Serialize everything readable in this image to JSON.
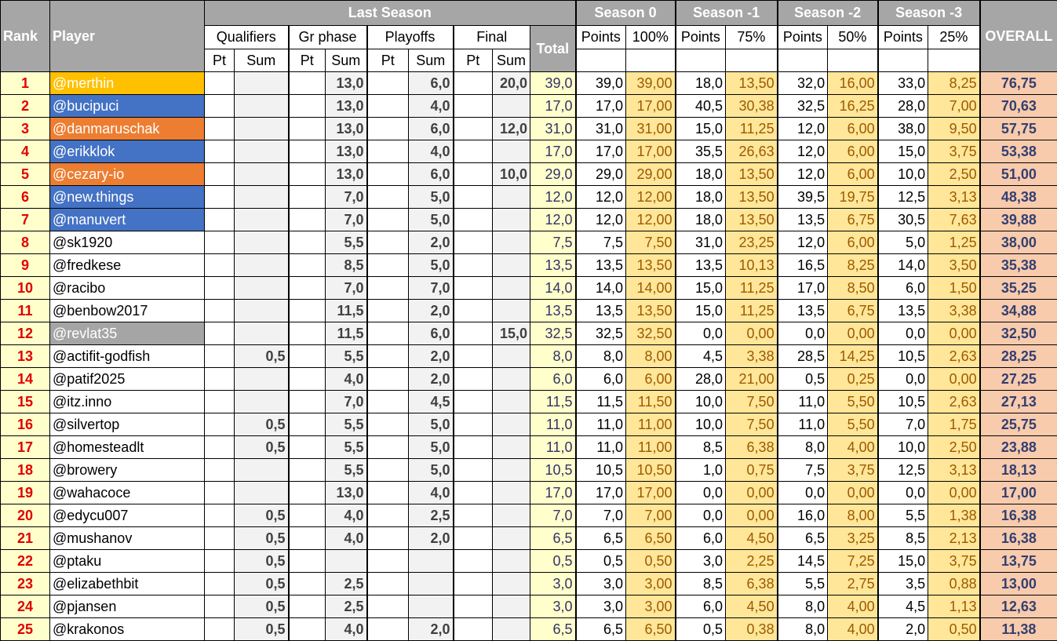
{
  "header": {
    "rank": "Rank",
    "player": "Player",
    "last_season": "Last Season",
    "total": "Total",
    "overall": "OVERALL",
    "stages": [
      "Qualifiers",
      "Gr phase",
      "Playoffs",
      "Final"
    ],
    "pt": "Pt",
    "sum": "Sum",
    "seasons": [
      {
        "name": "Season 0",
        "points": "Points",
        "weight": "100%"
      },
      {
        "name": "Season -1",
        "points": "Points",
        "weight": "75%"
      },
      {
        "name": "Season -2",
        "points": "Points",
        "weight": "50%"
      },
      {
        "name": "Season -3",
        "points": "Points",
        "weight": "25%"
      }
    ]
  },
  "colors": {
    "gold": "#ffc000",
    "blue": "#4472c4",
    "orange": "#ed7d31",
    "gray": "#a5a5a5"
  },
  "rows": [
    {
      "rank": "1",
      "player": "@merthin",
      "hl": "gold",
      "c": [
        "",
        "",
        "",
        "13,0",
        "",
        "6,0",
        "",
        "20,0",
        "39,0",
        "39,0",
        "39,00",
        "18,0",
        "13,50",
        "32,0",
        "16,00",
        "33,0",
        "8,25",
        "76,75"
      ]
    },
    {
      "rank": "2",
      "player": "@bucipuci",
      "hl": "blue",
      "c": [
        "",
        "",
        "",
        "13,0",
        "",
        "4,0",
        "",
        "",
        "17,0",
        "17,0",
        "17,00",
        "40,5",
        "30,38",
        "32,5",
        "16,25",
        "28,0",
        "7,00",
        "70,63"
      ]
    },
    {
      "rank": "3",
      "player": "@danmaruschak",
      "hl": "orange",
      "c": [
        "",
        "",
        "",
        "13,0",
        "",
        "6,0",
        "",
        "12,0",
        "31,0",
        "31,0",
        "31,00",
        "15,0",
        "11,25",
        "12,0",
        "6,00",
        "38,0",
        "9,50",
        "57,75"
      ]
    },
    {
      "rank": "4",
      "player": "@erikklok",
      "hl": "blue",
      "c": [
        "",
        "",
        "",
        "13,0",
        "",
        "4,0",
        "",
        "",
        "17,0",
        "17,0",
        "17,00",
        "35,5",
        "26,63",
        "12,0",
        "6,00",
        "15,0",
        "3,75",
        "53,38"
      ]
    },
    {
      "rank": "5",
      "player": "@cezary-io",
      "hl": "orange",
      "c": [
        "",
        "",
        "",
        "13,0",
        "",
        "6,0",
        "",
        "10,0",
        "29,0",
        "29,0",
        "29,00",
        "18,0",
        "13,50",
        "12,0",
        "6,00",
        "10,0",
        "2,50",
        "51,00"
      ]
    },
    {
      "rank": "6",
      "player": "@new.things",
      "hl": "blue",
      "c": [
        "",
        "",
        "",
        "7,0",
        "",
        "5,0",
        "",
        "",
        "12,0",
        "12,0",
        "12,00",
        "18,0",
        "13,50",
        "39,5",
        "19,75",
        "12,5",
        "3,13",
        "48,38"
      ]
    },
    {
      "rank": "7",
      "player": "@manuvert",
      "hl": "blue",
      "c": [
        "",
        "",
        "",
        "7,0",
        "",
        "5,0",
        "",
        "",
        "12,0",
        "12,0",
        "12,00",
        "18,0",
        "13,50",
        "13,5",
        "6,75",
        "30,5",
        "7,63",
        "39,88"
      ]
    },
    {
      "rank": "8",
      "player": "@sk1920",
      "hl": "",
      "c": [
        "",
        "",
        "",
        "5,5",
        "",
        "2,0",
        "",
        "",
        "7,5",
        "7,5",
        "7,50",
        "31,0",
        "23,25",
        "12,0",
        "6,00",
        "5,0",
        "1,25",
        "38,00"
      ]
    },
    {
      "rank": "9",
      "player": "@fredkese",
      "hl": "",
      "c": [
        "",
        "",
        "",
        "8,5",
        "",
        "5,0",
        "",
        "",
        "13,5",
        "13,5",
        "13,50",
        "13,5",
        "10,13",
        "16,5",
        "8,25",
        "14,0",
        "3,50",
        "35,38"
      ]
    },
    {
      "rank": "10",
      "player": "@racibo",
      "hl": "",
      "c": [
        "",
        "",
        "",
        "7,0",
        "",
        "7,0",
        "",
        "",
        "14,0",
        "14,0",
        "14,00",
        "15,0",
        "11,25",
        "17,0",
        "8,50",
        "6,0",
        "1,50",
        "35,25"
      ]
    },
    {
      "rank": "11",
      "player": "@benbow2017",
      "hl": "",
      "c": [
        "",
        "",
        "",
        "11,5",
        "",
        "2,0",
        "",
        "",
        "13,5",
        "13,5",
        "13,50",
        "15,0",
        "11,25",
        "13,5",
        "6,75",
        "13,5",
        "3,38",
        "34,88"
      ]
    },
    {
      "rank": "12",
      "player": "@revlat35",
      "hl": "gray",
      "c": [
        "",
        "",
        "",
        "11,5",
        "",
        "6,0",
        "",
        "15,0",
        "32,5",
        "32,5",
        "32,50",
        "0,0",
        "0,00",
        "0,0",
        "0,00",
        "0,0",
        "0,00",
        "32,50"
      ]
    },
    {
      "rank": "13",
      "player": "@actifit-godfish",
      "hl": "",
      "c": [
        "",
        "0,5",
        "",
        "5,5",
        "",
        "2,0",
        "",
        "",
        "8,0",
        "8,0",
        "8,00",
        "4,5",
        "3,38",
        "28,5",
        "14,25",
        "10,5",
        "2,63",
        "28,25"
      ]
    },
    {
      "rank": "14",
      "player": "@patif2025",
      "hl": "",
      "c": [
        "",
        "",
        "",
        "4,0",
        "",
        "2,0",
        "",
        "",
        "6,0",
        "6,0",
        "6,00",
        "28,0",
        "21,00",
        "0,5",
        "0,25",
        "0,0",
        "0,00",
        "27,25"
      ]
    },
    {
      "rank": "15",
      "player": "@itz.inno",
      "hl": "",
      "c": [
        "",
        "",
        "",
        "7,0",
        "",
        "4,5",
        "",
        "",
        "11,5",
        "11,5",
        "11,50",
        "10,0",
        "7,50",
        "11,0",
        "5,50",
        "10,5",
        "2,63",
        "27,13"
      ]
    },
    {
      "rank": "16",
      "player": "@silvertop",
      "hl": "",
      "c": [
        "",
        "0,5",
        "",
        "5,5",
        "",
        "5,0",
        "",
        "",
        "11,0",
        "11,0",
        "11,00",
        "10,0",
        "7,50",
        "11,0",
        "5,50",
        "7,0",
        "1,75",
        "25,75"
      ]
    },
    {
      "rank": "17",
      "player": "@homesteadlt",
      "hl": "",
      "c": [
        "",
        "0,5",
        "",
        "5,5",
        "",
        "5,0",
        "",
        "",
        "11,0",
        "11,0",
        "11,00",
        "8,5",
        "6,38",
        "8,0",
        "4,00",
        "10,0",
        "2,50",
        "23,88"
      ]
    },
    {
      "rank": "18",
      "player": "@browery",
      "hl": "",
      "c": [
        "",
        "",
        "",
        "5,5",
        "",
        "5,0",
        "",
        "",
        "10,5",
        "10,5",
        "10,50",
        "1,0",
        "0,75",
        "7,5",
        "3,75",
        "12,5",
        "3,13",
        "18,13"
      ]
    },
    {
      "rank": "19",
      "player": "@wahacoce",
      "hl": "",
      "c": [
        "",
        "",
        "",
        "13,0",
        "",
        "4,0",
        "",
        "",
        "17,0",
        "17,0",
        "17,00",
        "0,0",
        "0,00",
        "0,0",
        "0,00",
        "0,0",
        "0,00",
        "17,00"
      ]
    },
    {
      "rank": "20",
      "player": "@edycu007",
      "hl": "",
      "c": [
        "",
        "0,5",
        "",
        "4,0",
        "",
        "2,5",
        "",
        "",
        "7,0",
        "7,0",
        "7,00",
        "0,0",
        "0,00",
        "16,0",
        "8,00",
        "5,5",
        "1,38",
        "16,38"
      ]
    },
    {
      "rank": "21",
      "player": "@mushanov",
      "hl": "",
      "c": [
        "",
        "0,5",
        "",
        "4,0",
        "",
        "2,0",
        "",
        "",
        "6,5",
        "6,5",
        "6,50",
        "6,0",
        "4,50",
        "6,5",
        "3,25",
        "8,5",
        "2,13",
        "16,38"
      ]
    },
    {
      "rank": "22",
      "player": "@ptaku",
      "hl": "",
      "c": [
        "",
        "0,5",
        "",
        "",
        "",
        "",
        "",
        "",
        "0,5",
        "0,5",
        "0,50",
        "3,0",
        "2,25",
        "14,5",
        "7,25",
        "15,0",
        "3,75",
        "13,75"
      ]
    },
    {
      "rank": "23",
      "player": "@elizabethbit",
      "hl": "",
      "c": [
        "",
        "0,5",
        "",
        "2,5",
        "",
        "",
        "",
        "",
        "3,0",
        "3,0",
        "3,00",
        "8,5",
        "6,38",
        "5,5",
        "2,75",
        "3,5",
        "0,88",
        "13,00"
      ]
    },
    {
      "rank": "24",
      "player": "@pjansen",
      "hl": "",
      "c": [
        "",
        "0,5",
        "",
        "2,5",
        "",
        "",
        "",
        "",
        "3,0",
        "3,0",
        "3,00",
        "6,0",
        "4,50",
        "8,0",
        "4,00",
        "4,5",
        "1,13",
        "12,63"
      ]
    },
    {
      "rank": "25",
      "player": "@krakonos",
      "hl": "",
      "c": [
        "",
        "0,5",
        "",
        "4,0",
        "",
        "2,0",
        "",
        "",
        "6,5",
        "6,5",
        "6,50",
        "0,5",
        "0,38",
        "8,0",
        "4,00",
        "2,0",
        "0,50",
        "11,38"
      ]
    }
  ]
}
